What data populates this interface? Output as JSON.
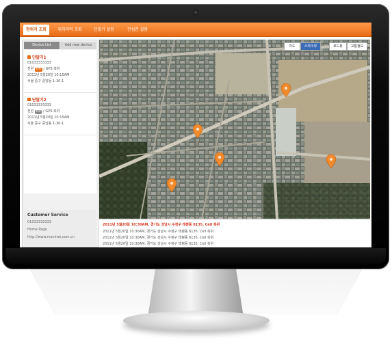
{
  "header": {
    "tabs": [
      {
        "label": "현위치 조회",
        "active": true
      },
      {
        "label": "위치이력 조회",
        "active": false
      },
      {
        "label": "단말기 설정",
        "active": false
      },
      {
        "label": "안심존 설정",
        "active": false
      }
    ]
  },
  "sidebar": {
    "tabs": [
      {
        "label": "Device List",
        "active": true
      },
      {
        "label": "Add new device",
        "active": false
      }
    ],
    "devices": [
      {
        "name": "단말기1",
        "phone": "01033333333",
        "status_prefix": "전원",
        "status_badge": "ON",
        "status_suffix": "/ GPS 측위",
        "time": "2011년 5월20일 10:15AM",
        "address": "서울 중구 중앙동 1-30-1"
      },
      {
        "name": "단말기2",
        "phone": "01033333333",
        "status_prefix": "전원",
        "status_badge": "Off",
        "status_suffix": "/ GPS 측위",
        "time": "2011년 5월20일 10:15AM",
        "address": "서울 중구 중앙동 1-30-1"
      }
    ],
    "customer_service": {
      "title": "Customer Service",
      "phone": "01033333333",
      "homepage_label": "Home Page",
      "url": "http://www.mevinet.com.cn"
    }
  },
  "map": {
    "type_buttons": [
      {
        "label": "지도",
        "active": false
      },
      {
        "label": "스카이뷰",
        "active": true
      },
      {
        "label": "로드뷰",
        "active": false
      },
      {
        "label": "교통정보",
        "active": false
      }
    ],
    "pin_color": "#f08a2c"
  },
  "log": {
    "lines": [
      "2011년 5월20일 10:30AM, 경기도 성남시 수정구 태평동 6135, Cell 측위",
      "2011년 5월20일 10:30AM, 경기도 성남시 수정구 태평동 6135, Cell 측위",
      "2011년 5월20일 10:30AM, 경기도 성남시 수정구 태평동 6135, Cell 측위",
      "2011년 5월20일 10:30AM, 경기도 성남시 수정구 태평동 6135, Cell 측위"
    ]
  },
  "colors": {
    "accent": "#ee7a22",
    "alert_text": "#d8331a"
  }
}
